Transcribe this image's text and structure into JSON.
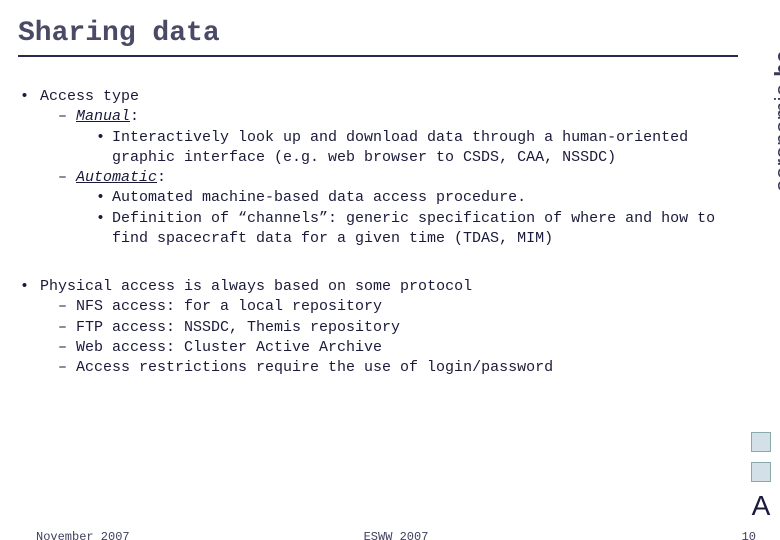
{
  "title": "Sharing data",
  "brand": {
    "main": "aeronomie",
    "dot": ".",
    "tld": "be"
  },
  "section1": {
    "heading": "Access type",
    "manual": {
      "label": "Manual",
      "colon": ":",
      "point1": "Interactively look up and download data through a human-oriented graphic interface (e.g. web browser to CSDS, CAA, NSSDC)"
    },
    "automatic": {
      "label": "Automatic",
      "colon": ":",
      "point1": "Automated machine-based data access procedure.",
      "point2": "Definition of “channels”: generic specification of where and how to find spacecraft data for a given time (TDAS, MIM)"
    }
  },
  "section2": {
    "heading": "Physical access is always based on some protocol",
    "items": [
      "NFS access: for a local repository",
      "FTP access: NSSDC, Themis repository",
      "Web access: Cluster Active Archive",
      "Access restrictions require the use of login/password"
    ]
  },
  "footer": {
    "left": "November 2007",
    "center": "ESWW 2007",
    "right": "10"
  }
}
